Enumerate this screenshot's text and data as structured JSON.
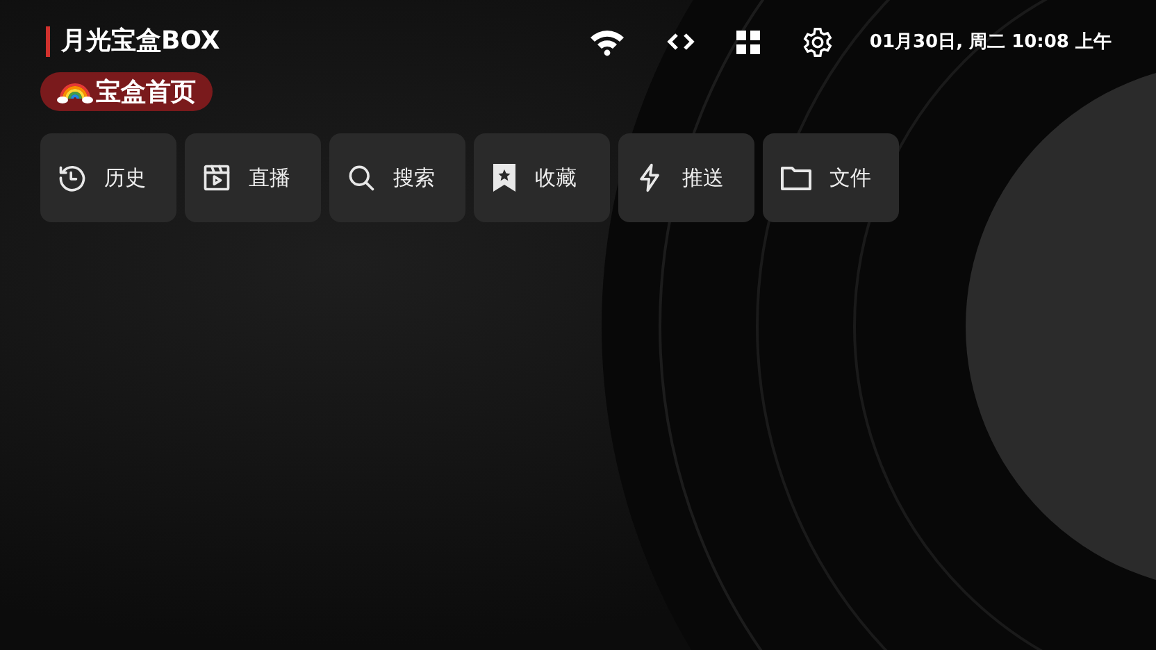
{
  "header": {
    "title": "月光宝盒BOX",
    "datetime": "01月30日, 周二 10:08 上午"
  },
  "status_icons": [
    {
      "kind": "wifi"
    },
    {
      "kind": "code"
    },
    {
      "kind": "grid"
    },
    {
      "kind": "settings"
    }
  ],
  "home_badge": {
    "label": "宝盒首页"
  },
  "shortcuts": [
    {
      "label": "历史",
      "kind": "history"
    },
    {
      "label": "直播",
      "kind": "live"
    },
    {
      "label": "搜索",
      "kind": "search"
    },
    {
      "label": "收藏",
      "kind": "favorite"
    },
    {
      "label": "推送",
      "kind": "push"
    },
    {
      "label": "文件",
      "kind": "file"
    }
  ]
}
